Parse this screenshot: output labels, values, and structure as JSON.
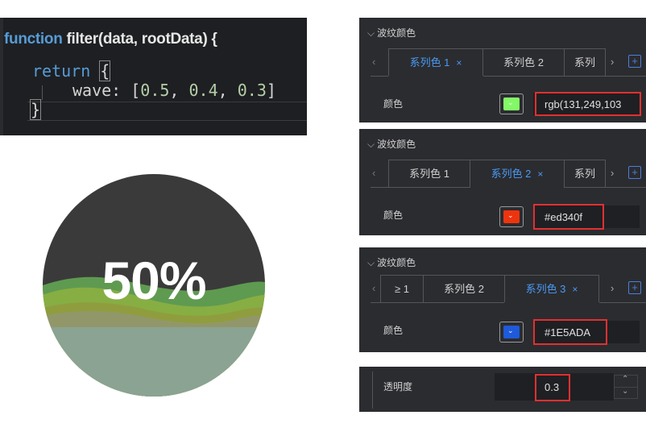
{
  "code": {
    "kw_function": "function",
    "signature": " filter(data, rootData) {",
    "kw_return": "return",
    "open_brace": "{",
    "wave_key": "wave: [",
    "v1": "0.5",
    "sep1": ", ",
    "v2": "0.4",
    "sep2": ", ",
    "v3": "0.3",
    "close_bracket": "]",
    "close_brace": "}"
  },
  "ball": {
    "percent_label": "50%",
    "value": 0.5,
    "wave_opacities": [
      0.5,
      0.4,
      0.3
    ],
    "colors": {
      "green": "#83f967",
      "red": "#ed340f",
      "blue": "#1E5ADA",
      "background": "#3a3a3a"
    }
  },
  "panels": [
    {
      "header": "波纹颜色",
      "tabs": [
        "系列色 1",
        "系列色 2",
        "系列"
      ],
      "active_tab": 0,
      "color_label": "颜色",
      "swatch_color": "#83f967",
      "value": "rgb(131,249,103"
    },
    {
      "header": "波纹颜色",
      "tabs": [
        "系列色 1",
        "系列色 2",
        "系列"
      ],
      "active_tab": 1,
      "color_label": "颜色",
      "swatch_color": "#ed340f",
      "value": "#ed340f"
    },
    {
      "header": "波纹颜色",
      "tabs": [
        "≥ 1",
        "系列色 2",
        "系列色 3"
      ],
      "active_tab": 2,
      "color_label": "颜色",
      "swatch_color": "#1E5ADA",
      "value": "#1E5ADA"
    }
  ],
  "opacity": {
    "label": "透明度",
    "value": "0.3"
  },
  "icons": {
    "close": "×",
    "left": "‹",
    "right": "›",
    "plus": "+",
    "chevron_down": "⌄",
    "collapse": "⌵",
    "up": "⌃",
    "down": "⌄"
  }
}
